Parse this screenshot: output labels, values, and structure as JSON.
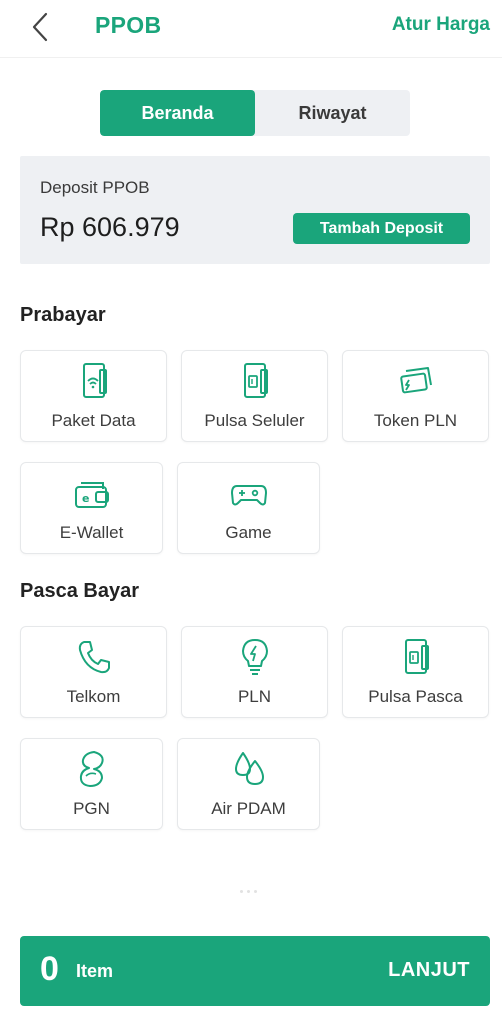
{
  "header": {
    "title": "PPOB",
    "price_link": "Atur Harga",
    "back_icon": "chevron-left-icon"
  },
  "tabs": [
    {
      "label": "Beranda",
      "active": true
    },
    {
      "label": "Riwayat",
      "active": false
    }
  ],
  "deposit": {
    "label": "Deposit PPOB",
    "amount": "Rp 606.979",
    "button": "Tambah Deposit"
  },
  "prabayar": {
    "title": "Prabayar",
    "items": [
      {
        "label": "Paket Data",
        "icon": "phone-wifi-icon"
      },
      {
        "label": "Pulsa Seluler",
        "icon": "phone-card-icon"
      },
      {
        "label": "Token PLN",
        "icon": "token-card-icon"
      },
      {
        "label": "E-Wallet",
        "icon": "wallet-icon"
      },
      {
        "label": "Game",
        "icon": "gamepad-icon"
      }
    ]
  },
  "pascabayar": {
    "title": "Pasca Bayar",
    "items": [
      {
        "label": "Telkom",
        "icon": "telephone-icon"
      },
      {
        "label": "PLN",
        "icon": "lightbulb-icon"
      },
      {
        "label": "Pulsa Pasca",
        "icon": "phone-card-icon"
      },
      {
        "label": "PGN",
        "icon": "gas-flame-icon"
      },
      {
        "label": "Air PDAM",
        "icon": "water-drops-icon"
      }
    ]
  },
  "footer": {
    "count": "0",
    "item_label": "Item",
    "next_label": "LANJUT"
  },
  "colors": {
    "accent": "#1aa57b",
    "card_bg": "#eef0f3"
  }
}
